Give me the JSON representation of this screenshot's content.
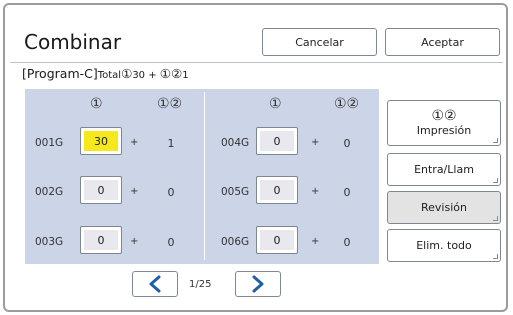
{
  "dialog": {
    "title": "Combinar",
    "cancel_label": "Cancelar",
    "accept_label": "Aceptar"
  },
  "program": {
    "name": "[Program-C]",
    "total_label": "Total",
    "sym1": "①",
    "count1": "30 + ",
    "sym12": "①②",
    "count12": "1"
  },
  "columns": [
    {
      "header_1": "①",
      "header_12": "①②"
    },
    {
      "header_1": "①",
      "header_12": "①②"
    }
  ],
  "rows": [
    {
      "group": "001G",
      "value1": "30",
      "plus": "+",
      "value12": "1"
    },
    {
      "group": "002G",
      "value1": "0",
      "plus": "+",
      "value12": "0"
    },
    {
      "group": "003G",
      "value1": "0",
      "plus": "+",
      "value12": "0"
    },
    {
      "group": "004G",
      "value1": "0",
      "plus": "+",
      "value12": "0"
    },
    {
      "group": "005G",
      "value1": "0",
      "plus": "+",
      "value12": "0"
    },
    {
      "group": "006G",
      "value1": "0",
      "plus": "+",
      "value12": "0"
    }
  ],
  "side_buttons": {
    "print_symbol": "①②",
    "print_label": "Impresión",
    "entry_label": "Entra/Llam",
    "review_label": "Revisión",
    "clear_label": "Elim. todo"
  },
  "pager": {
    "page_text": "1/25",
    "prev_icon": "chevron-left-icon",
    "next_icon": "chevron-right-icon"
  },
  "colors": {
    "panel": "#ccd5e8",
    "active_field": "#f5e81c",
    "accent_blue": "#1f5fa8"
  }
}
